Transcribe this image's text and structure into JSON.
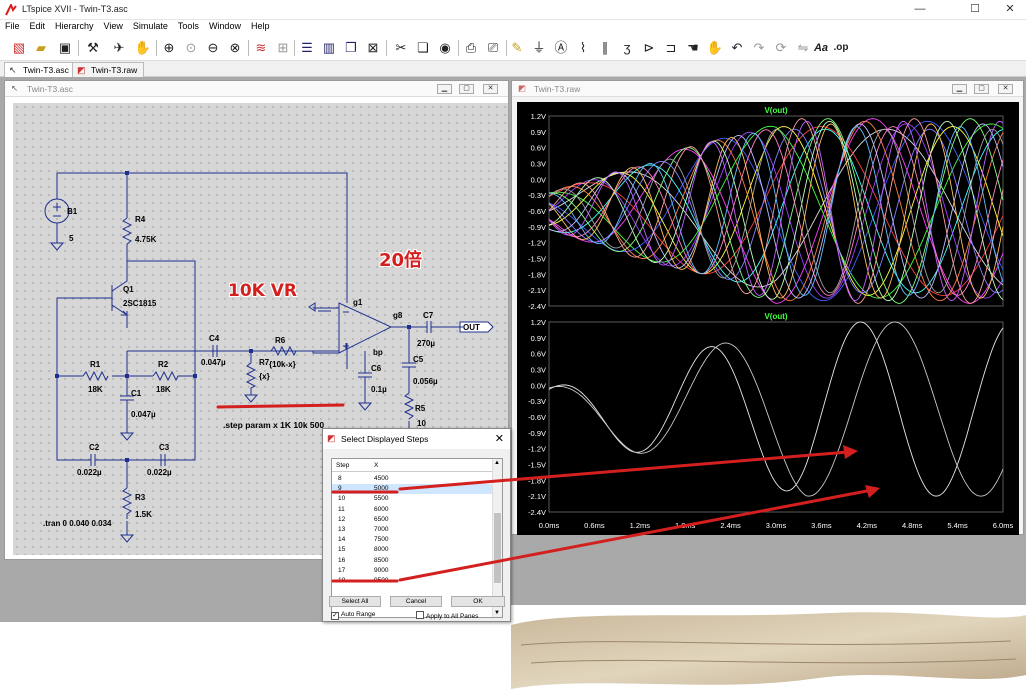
{
  "window": {
    "title": "LTspice XVII - Twin-T3.asc",
    "min": "—",
    "max": "☐",
    "close": "✕"
  },
  "menu": [
    "File",
    "Edit",
    "Hierarchy",
    "View",
    "Simulate",
    "Tools",
    "Window",
    "Help"
  ],
  "tabs": [
    {
      "label": "Twin-T3.asc",
      "active": true
    },
    {
      "label": "Twin-T3.raw",
      "active": false
    }
  ],
  "schematic": {
    "title": "Twin-T3.asc",
    "labels": {
      "b1": "B1",
      "b1v": "5",
      "r4": "R4",
      "r4v": "4.75K",
      "q1": "Q1",
      "q1v": "2SC1815",
      "r1": "R1",
      "r1v": "18K",
      "r2": "R2",
      "r2v": "18K",
      "c1": "C1",
      "c1v": "0.047µ",
      "c2": "C2",
      "c2v": "0.022µ",
      "c3": "C3",
      "c3v": "0.022µ",
      "r3": "R3",
      "r3v": "1.5K",
      "c4": "C4",
      "c4v": "0.047µ",
      "r6": "R6",
      "r6v": "{10k-x}",
      "r7": "R7",
      "r7v": "{x}",
      "g1": "g1",
      "g8": "g8",
      "bp": "bp",
      "c6": "C6",
      "c6v": "0.1µ",
      "c7": "C7",
      "c7v": "270µ",
      "c5": "C5",
      "c5v": "0.056µ",
      "r5": "R5",
      "r5v": "10",
      "out": "OUT",
      "step": ".step param x 1K 10k 500",
      "tran": ".tran 0 0.040 0.034"
    }
  },
  "plot": {
    "title": "Twin-T3.raw",
    "trace": "V(out)",
    "yticks": [
      "1.2V",
      "0.9V",
      "0.6V",
      "0.3V",
      "0.0V",
      "-0.3V",
      "-0.6V",
      "-0.9V",
      "-1.2V",
      "-1.5V",
      "-1.8V",
      "-2.1V",
      "-2.4V"
    ],
    "xticks": [
      "0.0ms",
      "0.6ms",
      "1.2ms",
      "1.8ms",
      "2.4ms",
      "3.0ms",
      "3.6ms",
      "4.2ms",
      "4.8ms",
      "5.4ms",
      "6.0ms"
    ]
  },
  "dialog": {
    "title": "Select Displayed Steps",
    "col_step": "Step",
    "col_x": "X",
    "rows": [
      {
        "step": "8",
        "x": "4500"
      },
      {
        "step": "9",
        "x": "5000"
      },
      {
        "step": "10",
        "x": "5500"
      },
      {
        "step": "11",
        "x": "6000"
      },
      {
        "step": "12",
        "x": "6500"
      },
      {
        "step": "13",
        "x": "7000"
      },
      {
        "step": "14",
        "x": "7500"
      },
      {
        "step": "15",
        "x": "8000"
      },
      {
        "step": "16",
        "x": "8500"
      },
      {
        "step": "17",
        "x": "9000"
      },
      {
        "step": "18",
        "x": "9500"
      }
    ],
    "select_all": "Select All",
    "cancel": "Cancel",
    "ok": "OK",
    "auto_range": "Auto Range",
    "apply_all": "Apply to All Panes"
  },
  "annotations": {
    "vr": "10K VR",
    "gain": "20倍"
  },
  "colors": {
    "annotation": "#d41f1f",
    "wire": "#1f2f8f",
    "grid": "#5a5a5a",
    "trace_colors": [
      "#e0e0e0",
      "#ff4040",
      "#40ff40",
      "#4060ff",
      "#ff40ff",
      "#40ffff",
      "#ffff40",
      "#a040ff",
      "#ff8040",
      "#80ff80",
      "#8080ff",
      "#ff80c0",
      "#c0c0ff",
      "#c0ffc0",
      "#ffa0a0",
      "#a0a0a0",
      "#60c0ff",
      "#ffc060",
      "#c060ff"
    ]
  }
}
